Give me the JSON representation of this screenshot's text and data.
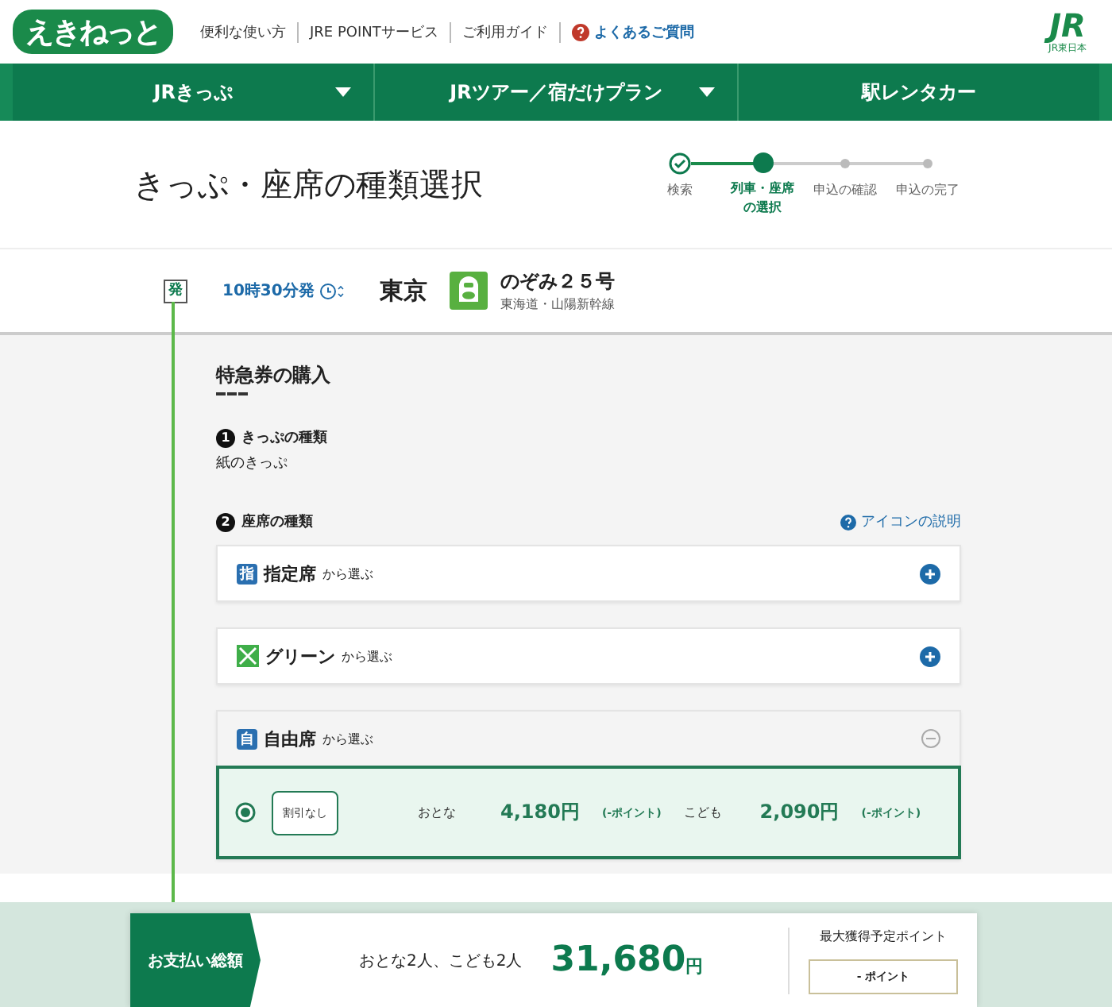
{
  "header": {
    "logo": "えきねっと",
    "links": [
      {
        "label": "便利な使い方"
      },
      {
        "label": "JRE POINTサービス"
      },
      {
        "label": "ご利用ガイド"
      },
      {
        "label": "よくあるご質問",
        "kind": "help"
      }
    ],
    "brand": {
      "mark": "JR",
      "sub": "JR東日本"
    }
  },
  "nav": [
    {
      "label": "JRきっぷ",
      "dropdown": true
    },
    {
      "label": "JRツアー／宿だけプラン",
      "dropdown": true
    },
    {
      "label": "駅レンタカー",
      "dropdown": false
    }
  ],
  "page_title": "きっぷ・座席の種類選択",
  "steps": [
    {
      "label": "検索",
      "completed": true,
      "selected": false
    },
    {
      "label": "列車・座席の選択",
      "completed": false,
      "selected": true
    },
    {
      "label": "申込の確認",
      "completed": false,
      "selected": false
    },
    {
      "label": "申込の完了",
      "completed": false,
      "selected": false
    }
  ],
  "departure": {
    "badge": "発",
    "time": "10時30分発",
    "station": "東京",
    "train_name": "のぞみ２５号",
    "line": "東海道・山陽新幹線"
  },
  "purchase": {
    "heading": "特急券の購入",
    "ticket_type": {
      "number": "1",
      "label": "きっぷの種類",
      "value": "紙のきっぷ"
    },
    "seat_type": {
      "number": "2",
      "label": "座席の種類",
      "help_link": "アイコンの説明"
    },
    "seat_options": [
      {
        "kind": "reserved",
        "badge": "指",
        "name": "指定席",
        "suffix": "から選ぶ",
        "expanded": false
      },
      {
        "kind": "green",
        "name": "グリーン",
        "suffix": "から選ぶ",
        "expanded": false
      },
      {
        "kind": "nonreserved",
        "badge": "自",
        "name": "自由席",
        "suffix": "から選ぶ",
        "expanded": true,
        "fares": [
          {
            "label": "割引なし",
            "selected": true,
            "adult_label": "おとな",
            "adult_price": "4,180円",
            "adult_points": "(-ポイント)",
            "child_label": "こども",
            "child_price": "2,090円",
            "child_points": "(-ポイント)"
          }
        ]
      }
    ]
  },
  "payment_bar": {
    "label": "お支払い総額",
    "passengers": "おとな2人、こども2人",
    "amount": "31,680",
    "currency": "円",
    "points_label": "最大獲得予定ポイント",
    "points_value": "- ポイント"
  }
}
